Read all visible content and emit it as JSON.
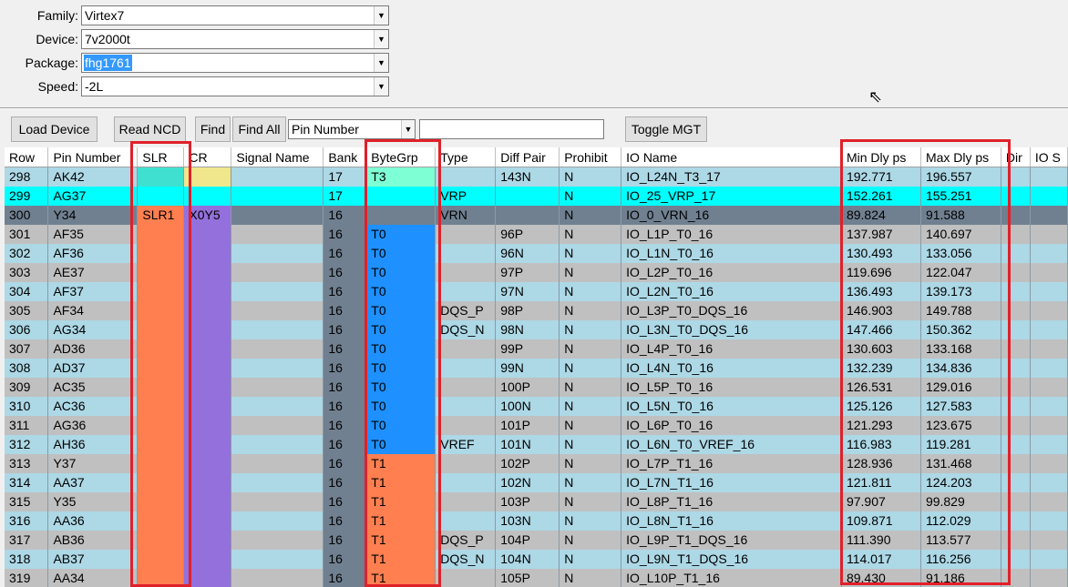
{
  "form": {
    "family_label": "Family:",
    "family_value": "Virtex7",
    "device_label": "Device:",
    "device_value": "7v2000t",
    "package_label": "Package:",
    "package_value": "fhg1761",
    "speed_label": "Speed:",
    "speed_value": "-2L"
  },
  "toolbar": {
    "load_device": "Load Device",
    "read_ncd": "Read NCD",
    "find": "Find",
    "find_all": "Find All",
    "search_field": "Pin Number",
    "search_text": ""
  },
  "toggle_mgt": "Toggle MGT",
  "table": {
    "columns": [
      "Row",
      "Pin Number",
      "SLR",
      "CR",
      "Signal Name",
      "Bank",
      "ByteGrp",
      "Type",
      "Diff Pair",
      "Prohibit",
      "IO Name",
      "Min Dly ps",
      "Max Dly ps",
      "Dir",
      "IO S"
    ],
    "rows": [
      [
        "298",
        "AK42",
        "",
        "",
        "",
        "17",
        "T3",
        "",
        "143N",
        "N",
        "IO_L24N_T3_17",
        "192.771",
        "196.557",
        "",
        ""
      ],
      [
        "299",
        "AG37",
        "",
        "",
        "",
        "17",
        "",
        "VRP",
        "",
        "N",
        "IO_25_VRP_17",
        "152.261",
        "155.251",
        "",
        ""
      ],
      [
        "300",
        "Y34",
        "SLR1",
        "X0Y5",
        "",
        "16",
        "",
        "VRN",
        "",
        "N",
        "IO_0_VRN_16",
        "89.824",
        "91.588",
        "",
        ""
      ],
      [
        "301",
        "AF35",
        "",
        "",
        "",
        "16",
        "T0",
        "",
        "96P",
        "N",
        "IO_L1P_T0_16",
        "137.987",
        "140.697",
        "",
        ""
      ],
      [
        "302",
        "AF36",
        "",
        "",
        "",
        "16",
        "T0",
        "",
        "96N",
        "N",
        "IO_L1N_T0_16",
        "130.493",
        "133.056",
        "",
        ""
      ],
      [
        "303",
        "AE37",
        "",
        "",
        "",
        "16",
        "T0",
        "",
        "97P",
        "N",
        "IO_L2P_T0_16",
        "119.696",
        "122.047",
        "",
        ""
      ],
      [
        "304",
        "AF37",
        "",
        "",
        "",
        "16",
        "T0",
        "",
        "97N",
        "N",
        "IO_L2N_T0_16",
        "136.493",
        "139.173",
        "",
        ""
      ],
      [
        "305",
        "AF34",
        "",
        "",
        "",
        "16",
        "T0",
        "DQS_P",
        "98P",
        "N",
        "IO_L3P_T0_DQS_16",
        "146.903",
        "149.788",
        "",
        ""
      ],
      [
        "306",
        "AG34",
        "",
        "",
        "",
        "16",
        "T0",
        "DQS_N",
        "98N",
        "N",
        "IO_L3N_T0_DQS_16",
        "147.466",
        "150.362",
        "",
        ""
      ],
      [
        "307",
        "AD36",
        "",
        "",
        "",
        "16",
        "T0",
        "",
        "99P",
        "N",
        "IO_L4P_T0_16",
        "130.603",
        "133.168",
        "",
        ""
      ],
      [
        "308",
        "AD37",
        "",
        "",
        "",
        "16",
        "T0",
        "",
        "99N",
        "N",
        "IO_L4N_T0_16",
        "132.239",
        "134.836",
        "",
        ""
      ],
      [
        "309",
        "AC35",
        "",
        "",
        "",
        "16",
        "T0",
        "",
        "100P",
        "N",
        "IO_L5P_T0_16",
        "126.531",
        "129.016",
        "",
        ""
      ],
      [
        "310",
        "AC36",
        "",
        "",
        "",
        "16",
        "T0",
        "",
        "100N",
        "N",
        "IO_L5N_T0_16",
        "125.126",
        "127.583",
        "",
        ""
      ],
      [
        "311",
        "AG36",
        "",
        "",
        "",
        "16",
        "T0",
        "",
        "101P",
        "N",
        "IO_L6P_T0_16",
        "121.293",
        "123.675",
        "",
        ""
      ],
      [
        "312",
        "AH36",
        "",
        "",
        "",
        "16",
        "T0",
        "VREF",
        "101N",
        "N",
        "IO_L6N_T0_VREF_16",
        "116.983",
        "119.281",
        "",
        ""
      ],
      [
        "313",
        "Y37",
        "",
        "",
        "",
        "16",
        "T1",
        "",
        "102P",
        "N",
        "IO_L7P_T1_16",
        "128.936",
        "131.468",
        "",
        ""
      ],
      [
        "314",
        "AA37",
        "",
        "",
        "",
        "16",
        "T1",
        "",
        "102N",
        "N",
        "IO_L7N_T1_16",
        "121.811",
        "124.203",
        "",
        ""
      ],
      [
        "315",
        "Y35",
        "",
        "",
        "",
        "16",
        "T1",
        "",
        "103P",
        "N",
        "IO_L8P_T1_16",
        "97.907",
        "99.829",
        "",
        ""
      ],
      [
        "316",
        "AA36",
        "",
        "",
        "",
        "16",
        "T1",
        "",
        "103N",
        "N",
        "IO_L8N_T1_16",
        "109.871",
        "112.029",
        "",
        ""
      ],
      [
        "317",
        "AB36",
        "",
        "",
        "",
        "16",
        "T1",
        "DQS_P",
        "104P",
        "N",
        "IO_L9P_T1_DQS_16",
        "111.390",
        "113.577",
        "",
        ""
      ],
      [
        "318",
        "AB37",
        "",
        "",
        "",
        "16",
        "T1",
        "DQS_N",
        "104N",
        "N",
        "IO_L9N_T1_DQS_16",
        "114.017",
        "116.256",
        "",
        ""
      ],
      [
        "319",
        "AA34",
        "",
        "",
        "",
        "16",
        "T1",
        "",
        "105P",
        "N",
        "IO_L10P_T1_16",
        "89.430",
        "91.186",
        "",
        ""
      ]
    ]
  },
  "colors": {
    "row_odd": "#add8e6",
    "row_even": "#c0c0c0",
    "row_selected": "#00ffff",
    "row_dark": "#708090",
    "slr": "#ff7f50",
    "cr": "#9370db",
    "bytegrp_t0": "#1e90ff",
    "bytegrp_t1": "#ff7f50",
    "highlight_box": "#e0202a"
  }
}
